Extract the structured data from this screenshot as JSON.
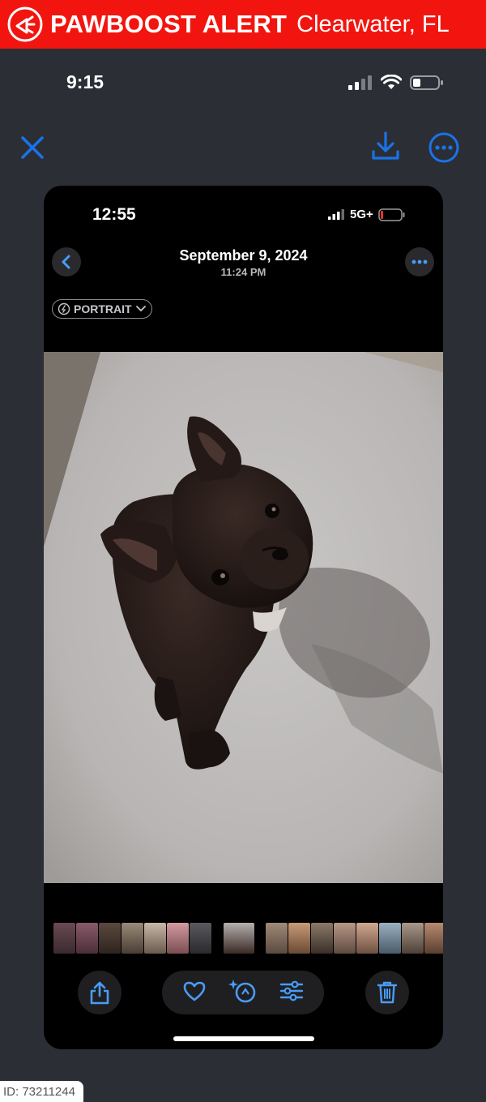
{
  "banner": {
    "brand": "PAWBOOST ALERT",
    "location": "Clearwater, FL",
    "color": "#f2150f"
  },
  "outer_status": {
    "time": "9:15"
  },
  "outer_toolbar": {
    "accent": "#1a73e8"
  },
  "inner_status": {
    "time": "12:55",
    "network": "5G+"
  },
  "photo_header": {
    "date": "September 9, 2024",
    "time": "11:24 PM",
    "mode_label": "PORTRAIT"
  },
  "thumbnail_count": 17,
  "footer": {
    "id_label": "ID: 73211244"
  },
  "icons": [
    "alert-megaphone-icon",
    "close-icon",
    "download-icon",
    "more-icon",
    "back-chevron-icon",
    "share-icon",
    "heart-icon",
    "magic-enhance-icon",
    "adjust-sliders-icon",
    "trash-icon"
  ]
}
